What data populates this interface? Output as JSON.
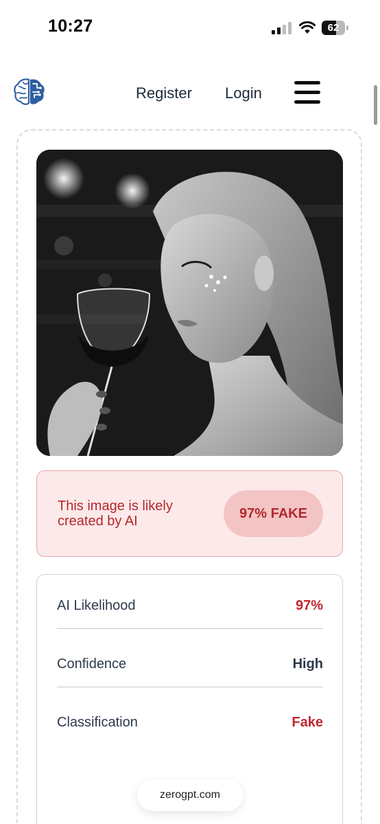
{
  "status_bar": {
    "time": "10:27",
    "battery_level": "62",
    "battery_fraction": 0.62,
    "icons": [
      "cellular-signal-icon",
      "wifi-icon",
      "battery-icon"
    ]
  },
  "header": {
    "logo": "brain-logo-icon",
    "nav": {
      "register": "Register",
      "login": "Login"
    },
    "menu_icon": "hamburger-menu-icon"
  },
  "result": {
    "image_description_icon": "analyzed-photo",
    "verdict": {
      "text": "This image is likely created by AI",
      "badge": "97% FAKE"
    },
    "metrics": [
      {
        "label": "AI Likelihood",
        "value": "97%"
      },
      {
        "label": "Confidence",
        "value": "High"
      },
      {
        "label": "Classification",
        "value": "Fake"
      }
    ]
  },
  "watermark": "zerogpt.com",
  "colors": {
    "accent_red": "#c0282f",
    "banner_bg": "#fce9e9",
    "badge_bg": "#f3c4c4",
    "text_dark": "#2e3a4b",
    "logo_blue": "#2f5f9e"
  }
}
